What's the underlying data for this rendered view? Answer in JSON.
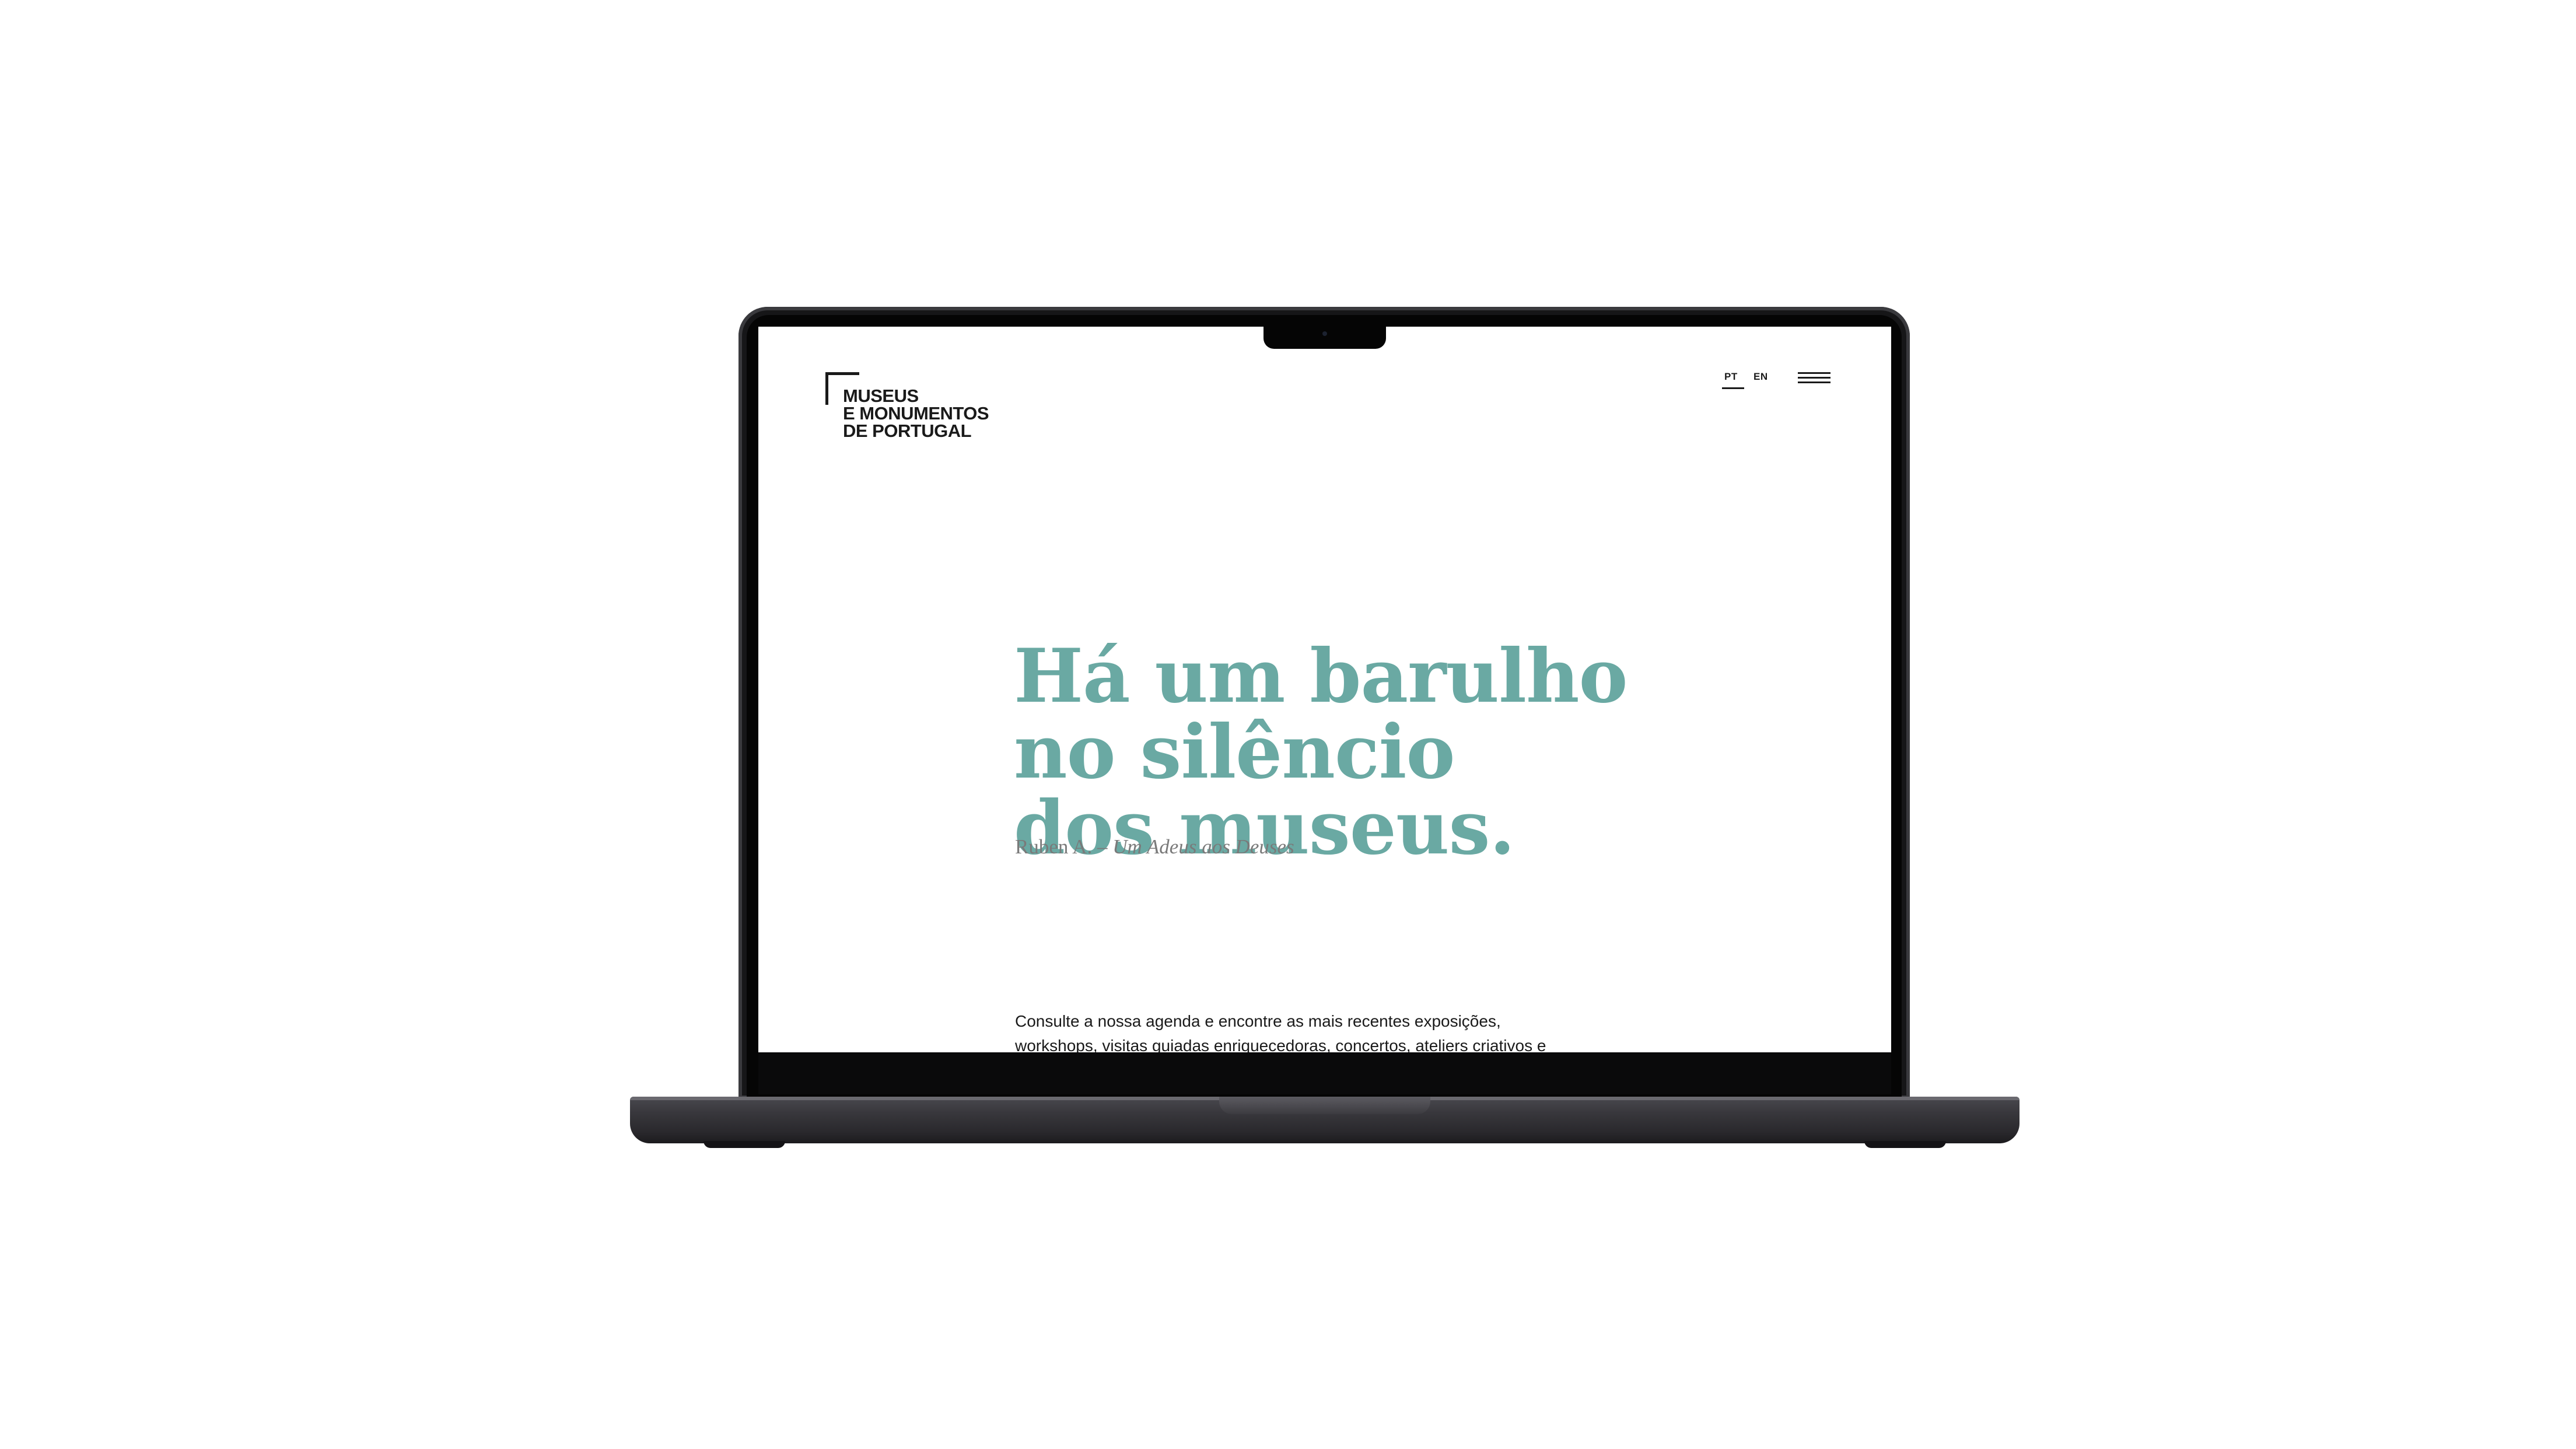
{
  "site": {
    "logo": {
      "line1": "MUSEUS",
      "line2": "E MONUMENTOS",
      "line3": "DE PORTUGAL"
    },
    "languages": {
      "pt": "PT",
      "en": "EN",
      "active": "PT"
    },
    "hero": {
      "line1": "Há um barulho",
      "line2": "no silêncio",
      "line3": "dos museus.",
      "author": "Ruben A. – ",
      "work": "Um Adeus aos Deuses"
    },
    "intro": {
      "text": "Consulte a nossa agenda e encontre as mais recentes exposições, workshops, visitas guiadas enriquecedoras, concertos, ateliers criativos e espetáculos."
    }
  },
  "colors": {
    "accent": "#6aa9a3",
    "text": "#1a1a1a",
    "muted": "#7a7a7a",
    "device": "#2e2d32"
  },
  "icons": {
    "menu": "hamburger-menu-icon",
    "logo_mark": "corner-bracket-icon"
  }
}
